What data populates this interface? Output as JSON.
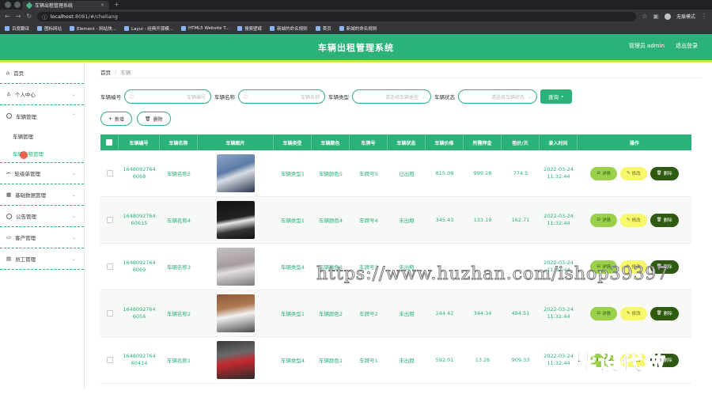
{
  "browser": {
    "tab_title": "车辆出租管理系统",
    "new_tab": "+",
    "url_host": "localhost",
    "url_path": ":8081/#/cheliang",
    "profile": "无痕模式",
    "bookmarks": [
      "百度翻译",
      "图标网站",
      "Element - 网站快...",
      "Layui - 经典开源模...",
      "HTML5 Website T...",
      "搜索壁纸",
      "新城的命名规则",
      "首页",
      "新城的命名规则"
    ]
  },
  "header": {
    "title": "车辆出租管理系统",
    "user": "管理员 admin",
    "logout": "退出登录"
  },
  "sidebar": {
    "items": [
      {
        "label": "首页"
      },
      {
        "label": "个人中心"
      },
      {
        "label": "车辆管理"
      },
      {
        "label": "车辆管理",
        "sub": true
      },
      {
        "label": "车辆出租管理",
        "sub": true,
        "active": true
      },
      {
        "label": "轮级单管理"
      },
      {
        "label": "基础数据管理"
      },
      {
        "label": "公告管理"
      },
      {
        "label": "客户管理"
      },
      {
        "label": "员工管理"
      }
    ]
  },
  "breadcrumb": {
    "home": "首页",
    "sep": "/",
    "current": "车辆"
  },
  "search": {
    "f1_label": "车辆编号",
    "f1_ph": "车辆编号",
    "f2_label": "车辆名称",
    "f2_ph": "车辆名称",
    "f3_label": "车辆类型",
    "f3_ph": "请选择车辆类型",
    "f4_label": "车辆状态",
    "f4_ph": "请选择车辆状态",
    "btn": "查询"
  },
  "actions": {
    "add": "新增",
    "delete": "删除"
  },
  "table": {
    "headers": [
      "车辆编号",
      "车辆名称",
      "车辆图片",
      "车辆类型",
      "车辆颜色",
      "车牌号",
      "车辆状态",
      "车辆价格",
      "所需押金",
      "租价/天",
      "录入时间",
      "操作"
    ],
    "rows": [
      {
        "code1": "1648092764",
        "code2": "6068",
        "name": "车辆名称5",
        "type": "车辆类型1",
        "color": "车辆颜色5",
        "plate": "车牌号5",
        "status": "已出租",
        "price": "815.08",
        "deposit": "999.28",
        "rent": "774.5",
        "date": "2022-03-24",
        "time": "11:32:44"
      },
      {
        "code1": "1648092764",
        "code2": "60615",
        "name": "车辆名称4",
        "type": "车辆类型1",
        "color": "车辆颜色4",
        "plate": "车牌号4",
        "status": "未出租",
        "price": "345.43",
        "deposit": "133.19",
        "rent": "162.71",
        "date": "2022-03-24",
        "time": "11:32:44"
      },
      {
        "code1": "1648092764",
        "code2": "6069",
        "name": "车辆名称3",
        "type": "车辆类型4",
        "color": "车辆颜色3",
        "plate": "车牌号3",
        "status": "未出租",
        "price": "",
        "deposit": "",
        "rent": "",
        "date": "2022-03-24",
        "time": "11:32:44"
      },
      {
        "code1": "1648092764",
        "code2": "6056",
        "name": "车辆名称2",
        "type": "车辆类型1",
        "color": "车辆颜色2",
        "plate": "车牌号2",
        "status": "未出租",
        "price": "244.42",
        "deposit": "344.34",
        "rent": "484.51",
        "date": "2022-03-24",
        "time": "11:32:44"
      },
      {
        "code1": "1648092764",
        "code2": "60414",
        "name": "车辆名称1",
        "type": "车辆类型4",
        "color": "车辆颜色1",
        "plate": "车牌号1",
        "status": "未出租",
        "price": "592.01",
        "deposit": "13.26",
        "rent": "909.33",
        "date": "2022-03-24",
        "time": "11:32:44"
      }
    ],
    "op_detail": "详情",
    "op_edit": "修改",
    "op_delete": "删除"
  },
  "overlay": {
    "watermark": "https://www.huzhan.com/ishop39397",
    "badge": "毕设代做"
  },
  "colors": {
    "primary": "#2bb27a",
    "accent": "#cce84a",
    "detail": "#9bd14a",
    "edit": "#f6f76a",
    "delete": "#2e5a12"
  }
}
